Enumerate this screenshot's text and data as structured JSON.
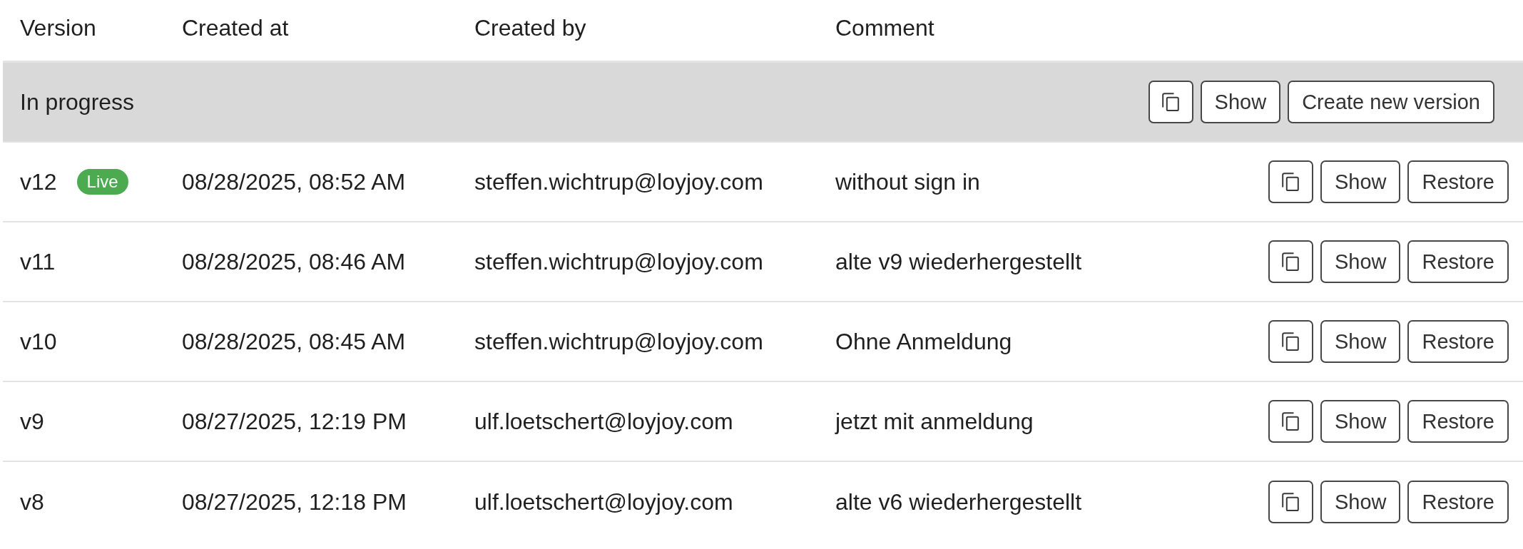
{
  "table": {
    "columns": [
      "Version",
      "Created at",
      "Created by",
      "Comment"
    ],
    "in_progress": {
      "label": "In progress",
      "actions": [
        {
          "kind": "copy"
        },
        {
          "kind": "show",
          "label": "Show"
        },
        {
          "kind": "create",
          "label": "Create new version"
        }
      ]
    },
    "rows": [
      {
        "version": "v12",
        "badge": "Live",
        "created_at": "08/28/2025, 08:52 AM",
        "created_by": "steffen.wichtrup@loyjoy.com",
        "comment": "without sign in",
        "actions": [
          {
            "kind": "copy"
          },
          {
            "kind": "show",
            "label": "Show"
          },
          {
            "kind": "restore",
            "label": "Restore"
          }
        ]
      },
      {
        "version": "v11",
        "created_at": "08/28/2025, 08:46 AM",
        "created_by": "steffen.wichtrup@loyjoy.com",
        "comment": "alte v9 wiederhergestellt",
        "actions": [
          {
            "kind": "copy"
          },
          {
            "kind": "show",
            "label": "Show"
          },
          {
            "kind": "restore",
            "label": "Restore"
          }
        ]
      },
      {
        "version": "v10",
        "created_at": "08/28/2025, 08:45 AM",
        "created_by": "steffen.wichtrup@loyjoy.com",
        "comment": "Ohne Anmeldung",
        "actions": [
          {
            "kind": "copy"
          },
          {
            "kind": "show",
            "label": "Show"
          },
          {
            "kind": "restore",
            "label": "Restore"
          }
        ]
      },
      {
        "version": "v9",
        "created_at": "08/27/2025, 12:19 PM",
        "created_by": "ulf.loetschert@loyjoy.com",
        "comment": "jetzt mit anmeldung",
        "actions": [
          {
            "kind": "copy"
          },
          {
            "kind": "show",
            "label": "Show"
          },
          {
            "kind": "restore",
            "label": "Restore"
          }
        ]
      },
      {
        "version": "v8",
        "created_at": "08/27/2025, 12:18 PM",
        "created_by": "ulf.loetschert@loyjoy.com",
        "comment": "alte v6 wiederhergestellt",
        "actions": [
          {
            "kind": "copy"
          },
          {
            "kind": "show",
            "label": "Show"
          },
          {
            "kind": "restore",
            "label": "Restore"
          }
        ]
      }
    ]
  }
}
